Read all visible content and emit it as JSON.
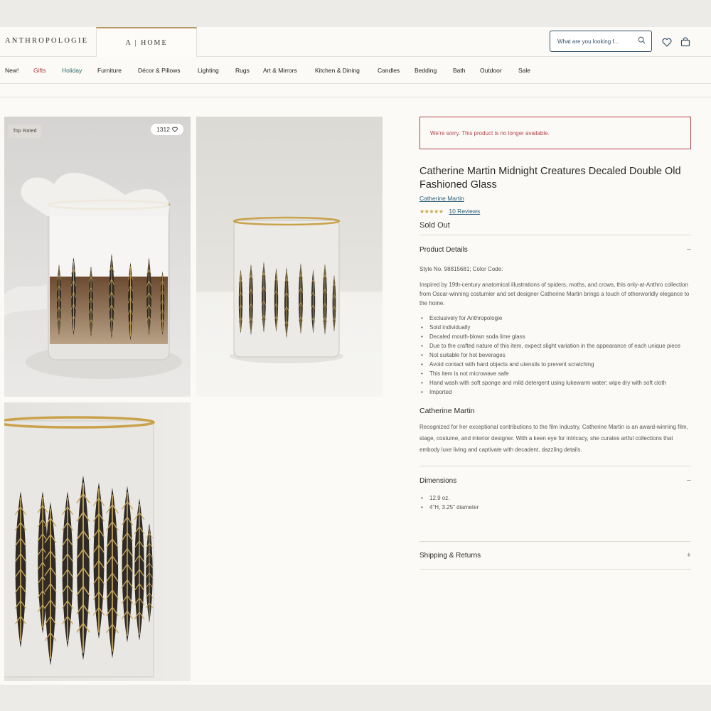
{
  "header": {
    "brand": "ANTHROPOLOGIE",
    "home_tab": "A | HOME",
    "search_placeholder": "What are you looking f...",
    "icons": [
      "search-icon",
      "heart-icon",
      "bag-icon"
    ]
  },
  "nav": {
    "items": [
      {
        "label": "New!",
        "color": "#222222"
      },
      {
        "label": "Gifts",
        "color": "#b33a3a"
      },
      {
        "label": "Holiday",
        "color": "#2d6a6a"
      },
      {
        "label": "Furniture",
        "color": "#222222"
      },
      {
        "label": "Décor & Pillows",
        "color": "#222222"
      },
      {
        "label": "Lighting",
        "color": "#222222"
      },
      {
        "label": "Rugs",
        "color": "#222222"
      },
      {
        "label": "Art & Mirrors",
        "color": "#222222"
      },
      {
        "label": "Kitchen & Dining",
        "color": "#222222"
      },
      {
        "label": "Candles",
        "color": "#222222"
      },
      {
        "label": "Bedding",
        "color": "#222222"
      },
      {
        "label": "Bath",
        "color": "#222222"
      },
      {
        "label": "Outdoor",
        "color": "#222222"
      },
      {
        "label": "Sale",
        "color": "#222222"
      }
    ]
  },
  "gallery": {
    "badge": "Top Rated",
    "likes": "1312"
  },
  "product": {
    "alert": "We're sorry. This product is no longer available.",
    "title": "Catherine Martin Midnight Creatures Decaled Double Old Fashioned Glass",
    "brand_link": "Catherine Martin",
    "rating": 4.5,
    "stars": "★★★★★",
    "reviews": "10 Reviews",
    "status": "Sold Out",
    "details": {
      "heading": "Product Details",
      "toggle": "−",
      "style": "Style No. 98815681; Color Code:",
      "description": "Inspired by 19th-century anatomical illustrations of spiders, moths, and crows, this only-at-Anthro collection from Oscar-winning costumier and set designer Catherine Martin brings a touch of otherworldly elegance to the home.",
      "bullets": [
        "Exclusively for Anthropologie",
        "Sold individually",
        "Decaled mouth-blown soda lime glass",
        "Due to the crafted nature of this item, expect slight variation in the appearance of each unique piece",
        "Not suitable for hot beverages",
        "Avoid contact with hard objects and utensils to prevent scratching",
        "This item is not microwave safe",
        "Hand wash with soft sponge and mild detergent using lukewarm water; wipe dry with soft cloth",
        "Imported"
      ],
      "designer_heading": "Catherine Martin",
      "designer_text": "Recognized for her exceptional contributions to the film industry, Catherine Martin is an award-winning film, stage, costume, and interior designer. With a keen eye for intricacy, she curates artful collections that embody luxe living and captivate with decadent, dazzling details."
    },
    "dimensions": {
      "heading": "Dimensions",
      "toggle": "−",
      "bullets": [
        "12.9 oz.",
        "4\"H, 3.25\" diameter"
      ]
    },
    "shipping": {
      "heading": "Shipping & Returns",
      "toggle": "+"
    }
  }
}
